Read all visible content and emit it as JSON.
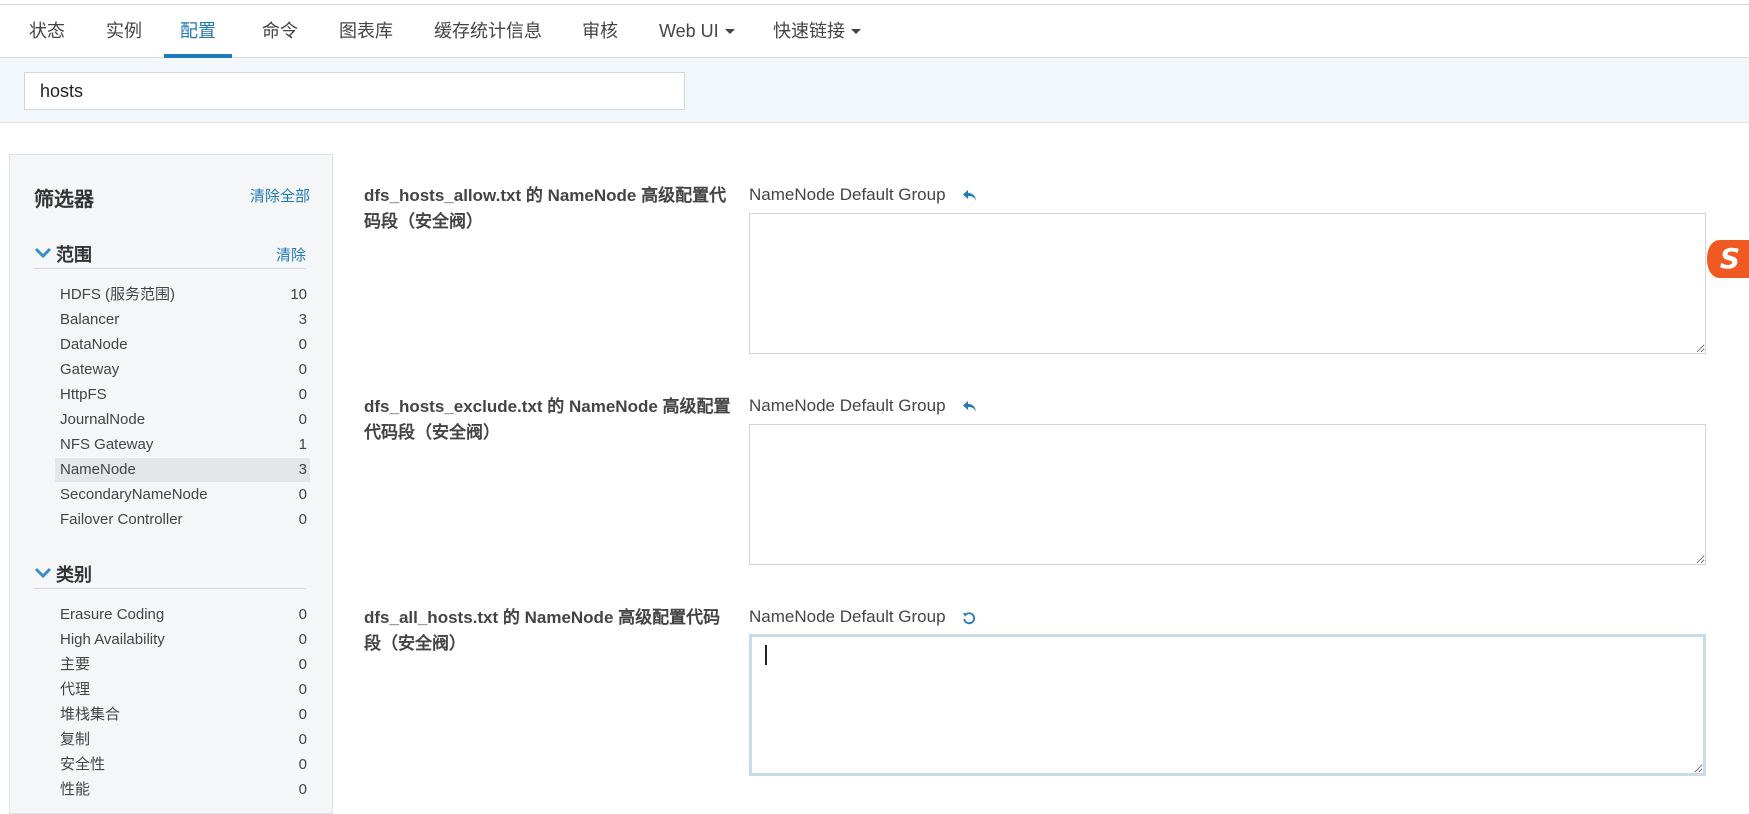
{
  "tabs": [
    {
      "label": "状态"
    },
    {
      "label": "实例"
    },
    {
      "label": "配置",
      "active": true
    },
    {
      "label": "命令"
    },
    {
      "label": "图表库"
    },
    {
      "label": "缓存统计信息"
    },
    {
      "label": "审核"
    },
    {
      "label": "Web UI",
      "dropdown": true
    },
    {
      "label": "快速链接",
      "dropdown": true
    }
  ],
  "search": {
    "value": "hosts"
  },
  "sidebar": {
    "title": "筛选器",
    "clear_all": "清除全部",
    "scope": {
      "title": "范围",
      "clear": "清除",
      "items": [
        {
          "label": "HDFS (服务范围)",
          "count": "10"
        },
        {
          "label": "Balancer",
          "count": "3"
        },
        {
          "label": "DataNode",
          "count": "0"
        },
        {
          "label": "Gateway",
          "count": "0"
        },
        {
          "label": "HttpFS",
          "count": "0"
        },
        {
          "label": "JournalNode",
          "count": "0"
        },
        {
          "label": "NFS Gateway",
          "count": "1"
        },
        {
          "label": "NameNode",
          "count": "3",
          "selected": true
        },
        {
          "label": "SecondaryNameNode",
          "count": "0"
        },
        {
          "label": "Failover Controller",
          "count": "0"
        }
      ]
    },
    "category": {
      "title": "类别",
      "items": [
        {
          "label": "Erasure Coding",
          "count": "0"
        },
        {
          "label": "High Availability",
          "count": "0"
        },
        {
          "label": "主要",
          "count": "0"
        },
        {
          "label": "代理",
          "count": "0"
        },
        {
          "label": "堆栈集合",
          "count": "0"
        },
        {
          "label": "复制",
          "count": "0"
        },
        {
          "label": "安全性",
          "count": "0"
        },
        {
          "label": "性能",
          "count": "0"
        }
      ]
    }
  },
  "configs": [
    {
      "name": "dfs_hosts_allow.txt 的 NameNode 高级配置代码段（安全阀）",
      "group": "NameNode Default Group",
      "value": "",
      "revert_icon": "undo-arrow-icon"
    },
    {
      "name": "dfs_hosts_exclude.txt 的 NameNode 高级配置代码段（安全阀）",
      "group": "NameNode Default Group",
      "value": "",
      "revert_icon": "undo-arrow-icon"
    },
    {
      "name": "dfs_all_hosts.txt 的 NameNode 高级配置代码段（安全阀）",
      "group": "NameNode Default Group",
      "value": "",
      "revert_icon": "reset-circular-icon"
    }
  ],
  "colors": {
    "accent": "#1f7ab7",
    "sidebar_bg": "#f4f6f8",
    "search_band": "#f2f7fb",
    "sogou": "#f05a22"
  }
}
